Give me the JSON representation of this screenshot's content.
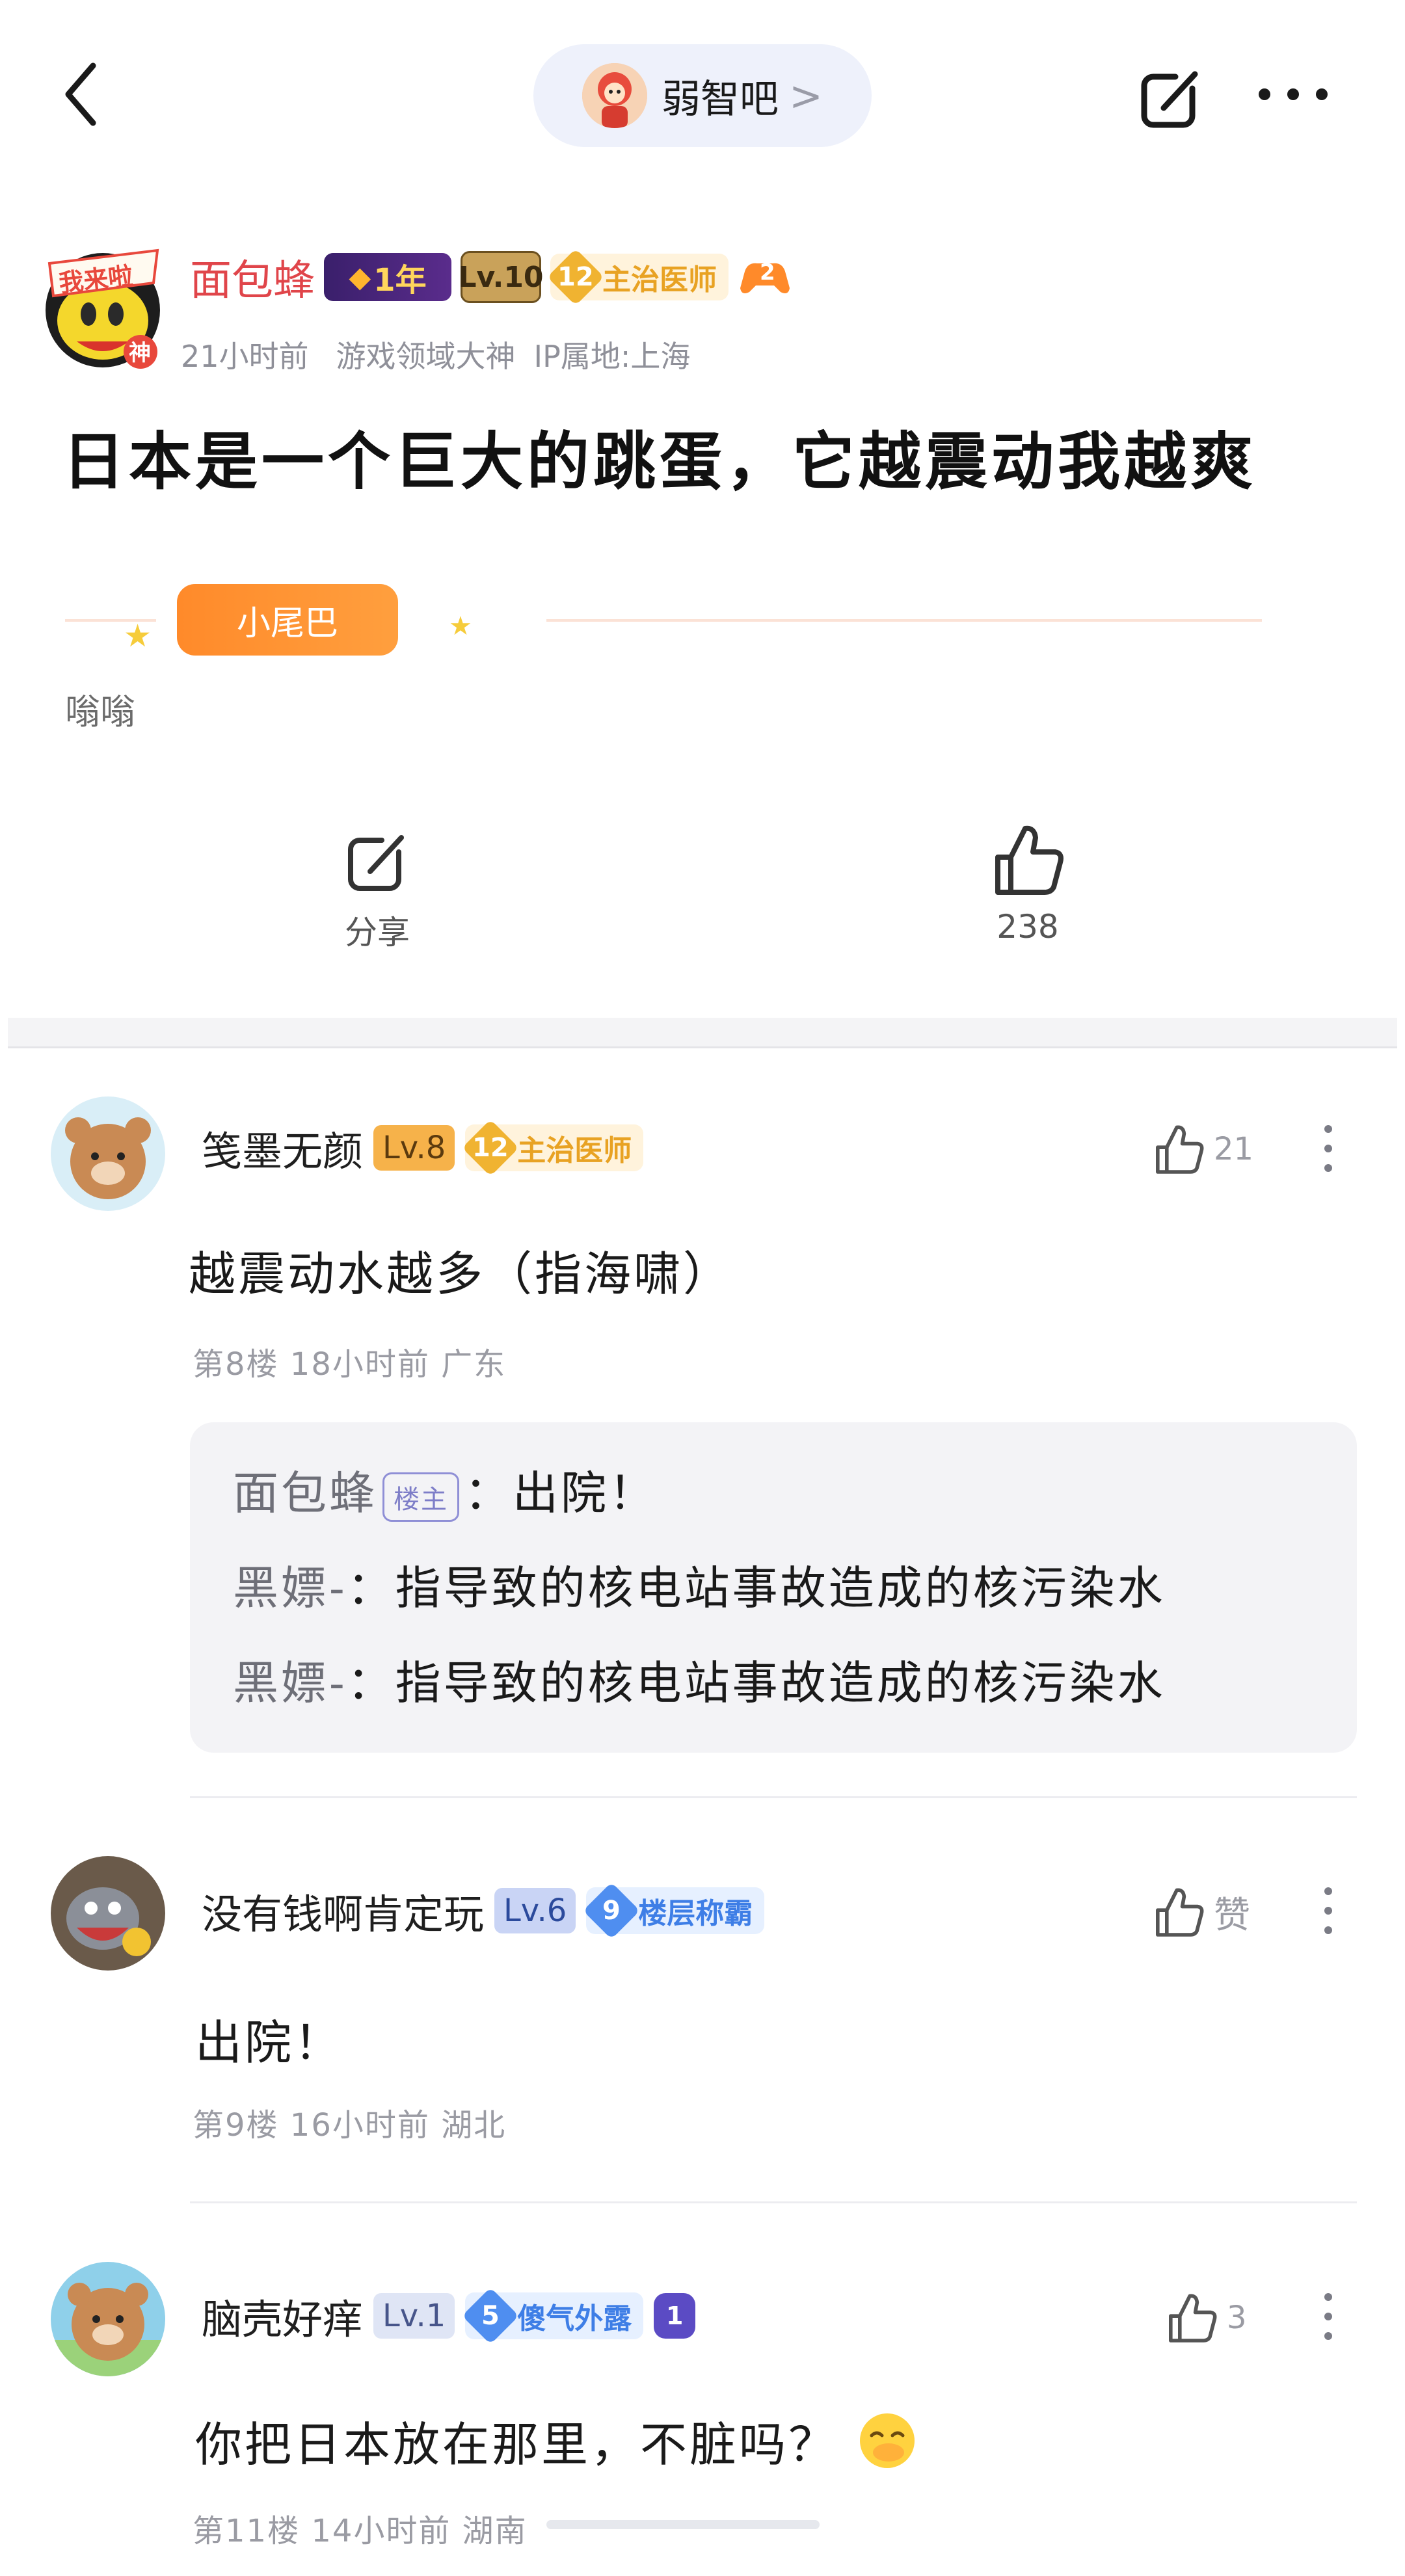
{
  "topbar": {
    "forum_name": "弱智吧",
    "chevron": ">"
  },
  "post": {
    "author": "面包蜂",
    "avatar_badge": "神",
    "avatar_text": "我来啦",
    "years_badge": "1年",
    "level": "Lv.10",
    "title_level": "12",
    "title_name": "主治医师",
    "extra_badge": "2",
    "time": "21小时前",
    "tag": "游戏领域大神",
    "ip": "IP属地:上海",
    "title": "日本是一个巨大的跳蛋，它越震动我越爽",
    "tail_label": "小尾巴",
    "tail_text": "嗡嗡",
    "share_label": "分享",
    "like_count": "238"
  },
  "comments": [
    {
      "name": "笺墨无颜",
      "level": "Lv.8",
      "title_level": "12",
      "title_name": "主治医师",
      "likes": "21",
      "body": "越震动水越多（指海啸）",
      "meta": "第8楼  18小时前  广东",
      "replies": [
        {
          "who": "面包蜂",
          "op_tag": "楼主",
          "text": "：出院！"
        },
        {
          "who": "黑嫖-",
          "text": "：指导致的核电站事故造成的核污染水"
        },
        {
          "who": "黑嫖-",
          "text": "：指导致的核电站事故造成的核污染水"
        }
      ]
    },
    {
      "name": "没有钱啊肯定玩",
      "level": "Lv.6",
      "title_level": "9",
      "title_name": "楼层称霸",
      "likes": "赞",
      "body": "出院！",
      "meta": "第9楼  16小时前  湖北"
    },
    {
      "name": "脑壳好痒",
      "level": "Lv.1",
      "title_level": "5",
      "title_name": "傻气外露",
      "extra_badge": "1",
      "likes": "3",
      "body": "你把日本放在那里，不脏吗？",
      "meta": "第11楼  14小时前  湖南"
    }
  ],
  "colors": {
    "accent_red": "#e0454a",
    "orange": "#ff8a2a",
    "blue_badge": "#4f8ef0",
    "gold": "#f0b331"
  }
}
